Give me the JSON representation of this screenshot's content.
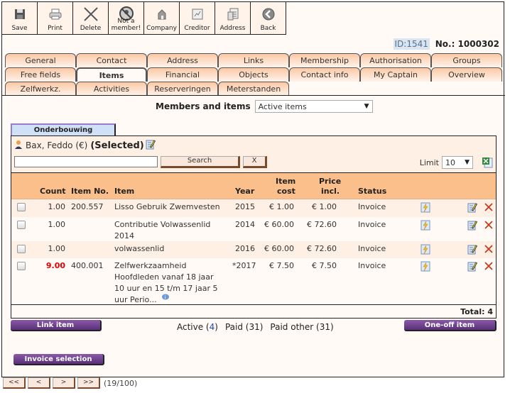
{
  "toolbar": {
    "buttons": [
      {
        "label": "Save",
        "icon": "floppy-disk-icon"
      },
      {
        "label": "Print",
        "icon": "printer-icon"
      },
      {
        "label": "Delete",
        "icon": "x-icon"
      },
      {
        "label": "Not a member!",
        "icon": "no-member-icon"
      },
      {
        "label": "Company",
        "icon": "building-icon"
      },
      {
        "label": "Creditor",
        "icon": "creditor-icon"
      },
      {
        "label": "Address",
        "icon": "address-card-icon"
      },
      {
        "label": "Back",
        "icon": "back-arrow-icon"
      }
    ]
  },
  "record": {
    "id_label": "ID:1541",
    "number_label": "No.: 1000302"
  },
  "tabs": {
    "row1": [
      "General",
      "Contact",
      "Address",
      "Links",
      "Membership",
      "Authorisation",
      "Groups"
    ],
    "row2": [
      "Free fields",
      "Items",
      "Financial",
      "Objects",
      "Contact info",
      "My Captain",
      "Overview"
    ],
    "row3": [
      "Zelfwerkz.",
      "Activities",
      "Reserveringen",
      "Meterstanden"
    ],
    "active": "Items"
  },
  "filter": {
    "label": "Members and items",
    "selected": "Active items"
  },
  "subtab": {
    "label": "Onderbouwing"
  },
  "person": {
    "name": "Bax, Feddo (€)",
    "state": "(Selected)"
  },
  "search": {
    "value": "",
    "button": "Search",
    "clear": "X"
  },
  "limit": {
    "label": "Limit",
    "selected": "10"
  },
  "table": {
    "headers": {
      "count": "Count",
      "item_no": "Item No.",
      "item": "Item",
      "year": "Year",
      "item_cost_1": "Item",
      "item_cost_2": "cost",
      "price_1": "Price",
      "price_2": "incl.",
      "status": "Status"
    },
    "rows": [
      {
        "count": "1.00",
        "item_no": "200.557",
        "item_lines": [
          "Lisso Gebruik Zwemvesten"
        ],
        "year": "2015",
        "cost": "€ 1.00",
        "price": "€ 1.00",
        "status": "Invoice",
        "count_alert": false
      },
      {
        "count": "1.00",
        "item_no": "",
        "item_lines": [
          "Contributie Volwassenlid",
          "2014"
        ],
        "year": "2014",
        "cost": "€ 60.00",
        "price": "€ 72.60",
        "status": "Invoice",
        "count_alert": false
      },
      {
        "count": "1.00",
        "item_no": "",
        "item_lines": [
          "volwassenlid"
        ],
        "year": "2016",
        "cost": "€ 60.00",
        "price": "€ 72.60",
        "status": "Invoice",
        "count_alert": false
      },
      {
        "count": "9.00",
        "item_no": "400.001",
        "item_lines": [
          "Zelfwerkzaamheid",
          "Hoofdleden vanaf 18 jaar",
          "10 uur en 15 t/m 17 jaar 5",
          "uur Perio..."
        ],
        "year": "*2017",
        "cost": "€ 7.50",
        "price": "€ 7.50",
        "status": "Invoice",
        "count_alert": true
      }
    ],
    "total": "Total: 4"
  },
  "actions": {
    "link_item": "Link item",
    "one_off": "One-off item",
    "invoice_selection": "Invoice selection"
  },
  "counts": {
    "active_label": "Active (",
    "active_num": "4",
    "active_close": ")",
    "paid": "Paid (31)",
    "paid_other": "Paid other (31)"
  },
  "pager": {
    "first": "<<",
    "prev": "<",
    "next": ">",
    "last": ">>",
    "position": "(19/100)"
  },
  "colors": {
    "accent_purple": "#5a2e7a",
    "header_orange": "#fbbf8c",
    "alert_red": "#dd0000"
  }
}
